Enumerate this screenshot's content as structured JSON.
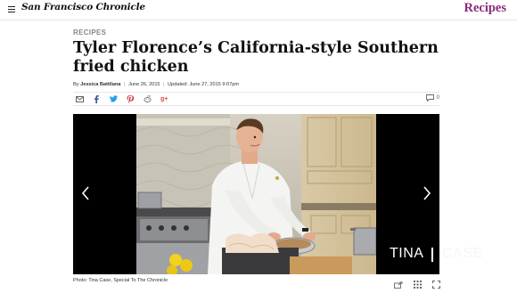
{
  "header": {
    "logo_text": "San Francisco Chronicle",
    "section_label": "Recipes",
    "section_color": "#8c2a7b"
  },
  "article": {
    "kicker": "RECIPES",
    "headline": "Tyler Florence’s California-style Southern fried chicken",
    "byline_prefix": "By",
    "author": "Jessica Battilana",
    "published": "June 26, 2015",
    "updated": "Updated: June 27, 2015 9:07pm"
  },
  "share": {
    "icons": [
      "email-icon",
      "facebook-icon",
      "twitter-icon",
      "pinterest-icon",
      "reddit-icon",
      "google-plus-icon"
    ],
    "comment_count": "0"
  },
  "gallery": {
    "caption": "Photo: Tina Case, Special To The Chronicle",
    "watermark": "TINA",
    "watermark_fade": "CASE"
  }
}
